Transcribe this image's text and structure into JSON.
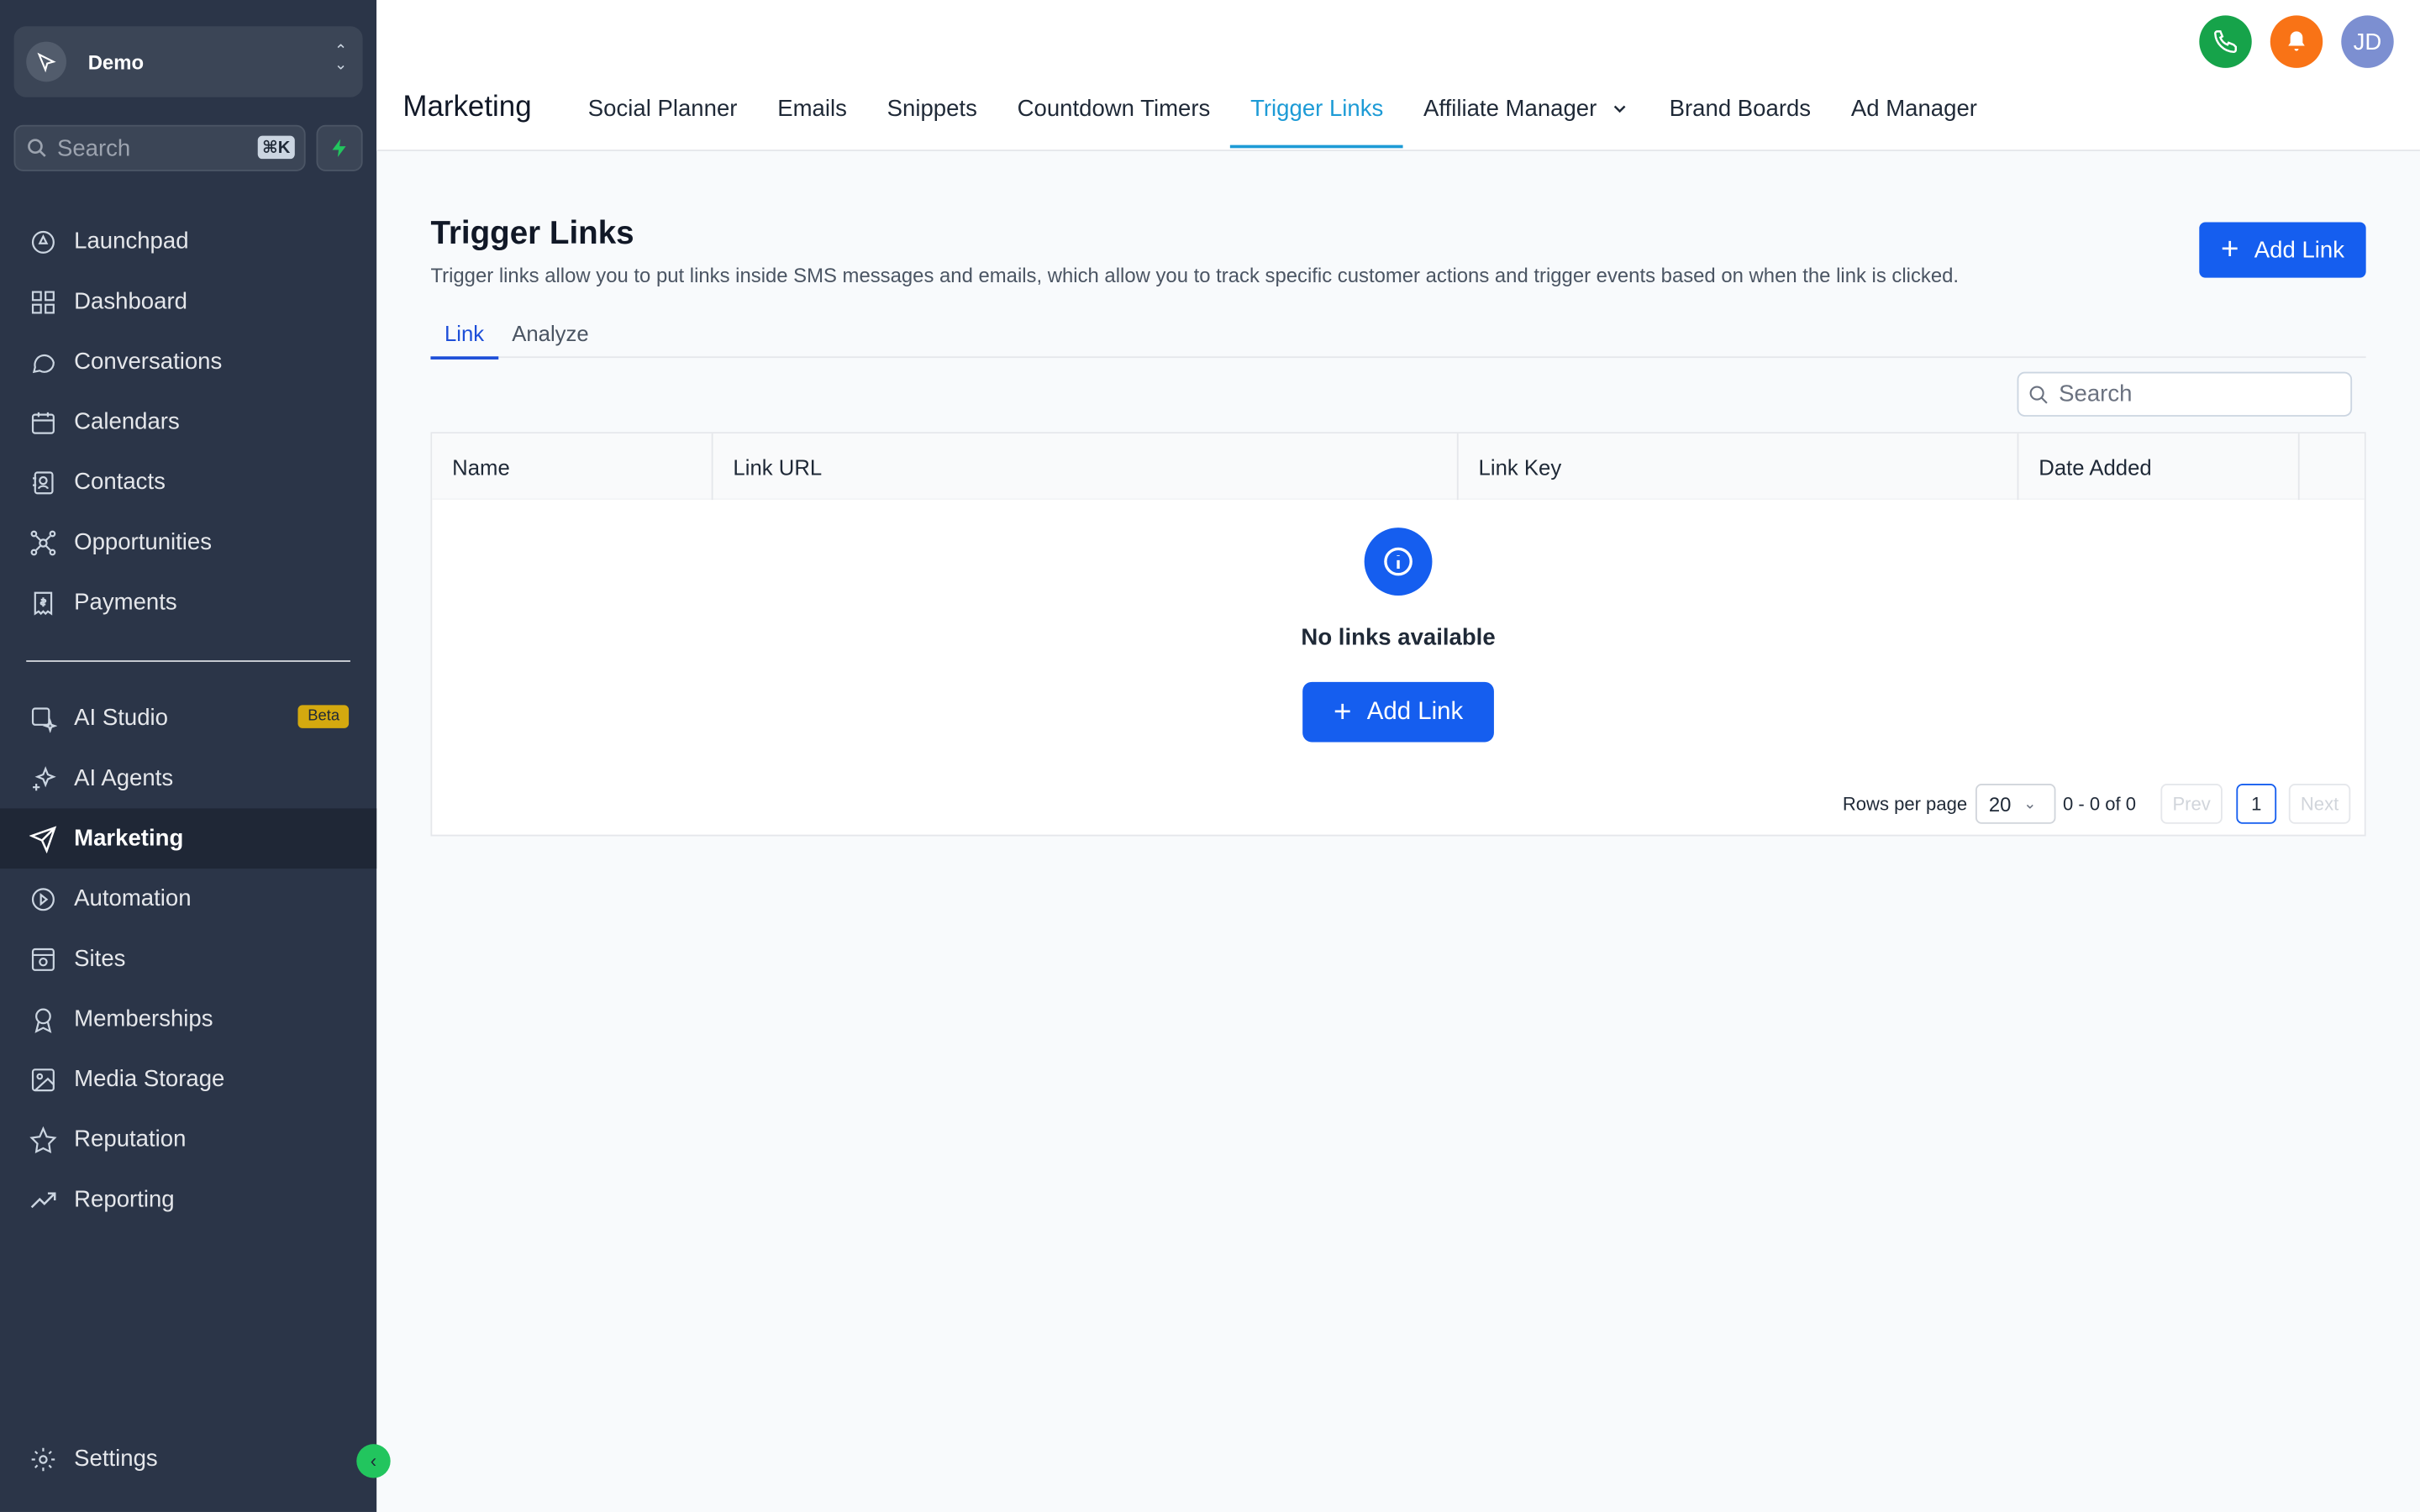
{
  "sidebar": {
    "account_name": "Demo",
    "search_label": "Search",
    "search_shortcut": "⌘K",
    "items_top": [
      {
        "label": "Launchpad",
        "icon": "rocket-icon"
      },
      {
        "label": "Dashboard",
        "icon": "dashboard-icon"
      },
      {
        "label": "Conversations",
        "icon": "chat-icon"
      },
      {
        "label": "Calendars",
        "icon": "calendar-icon"
      },
      {
        "label": "Contacts",
        "icon": "contacts-icon"
      },
      {
        "label": "Opportunities",
        "icon": "opportunities-icon"
      },
      {
        "label": "Payments",
        "icon": "payments-icon"
      }
    ],
    "items_bottom": [
      {
        "label": "AI Studio",
        "icon": "ai-studio-icon",
        "badge": "Beta"
      },
      {
        "label": "AI Agents",
        "icon": "sparkle-icon"
      },
      {
        "label": "Marketing",
        "icon": "send-icon",
        "active": true
      },
      {
        "label": "Automation",
        "icon": "automation-icon"
      },
      {
        "label": "Sites",
        "icon": "sites-icon"
      },
      {
        "label": "Memberships",
        "icon": "award-icon"
      },
      {
        "label": "Media Storage",
        "icon": "image-icon"
      },
      {
        "label": "Reputation",
        "icon": "star-icon"
      },
      {
        "label": "Reporting",
        "icon": "trend-icon"
      }
    ],
    "settings_label": "Settings"
  },
  "header": {
    "title": "Marketing",
    "tabs": [
      "Social Planner",
      "Emails",
      "Snippets",
      "Countdown Timers",
      "Trigger Links",
      "Affiliate Manager",
      "Brand Boards",
      "Ad Manager"
    ],
    "active_tab": "Trigger Links",
    "avatar_initials": "JD",
    "colors": {
      "phone": "#16a34a",
      "bell": "#f97316",
      "avatar": "#7c8fd1",
      "accent": "#1d9bd6"
    }
  },
  "main": {
    "title": "Trigger Links",
    "description": "Trigger links allow you to put links inside SMS messages and emails, which allow you to track specific customer actions and trigger events based on when the link is clicked.",
    "add_link_label": "Add Link",
    "subtabs": [
      "Link",
      "Analyze"
    ],
    "search_placeholder": "Search",
    "table": {
      "columns": [
        "Name",
        "Link URL",
        "Link Key",
        "Date Added"
      ],
      "empty_text": "No links available",
      "add_link_label": "Add Link"
    },
    "pagination": {
      "rows_per_page_label": "Rows per page",
      "rows_per_page": "20",
      "range": "0 - 0 of 0",
      "prev": "Prev",
      "page": "1",
      "next": "Next"
    }
  }
}
